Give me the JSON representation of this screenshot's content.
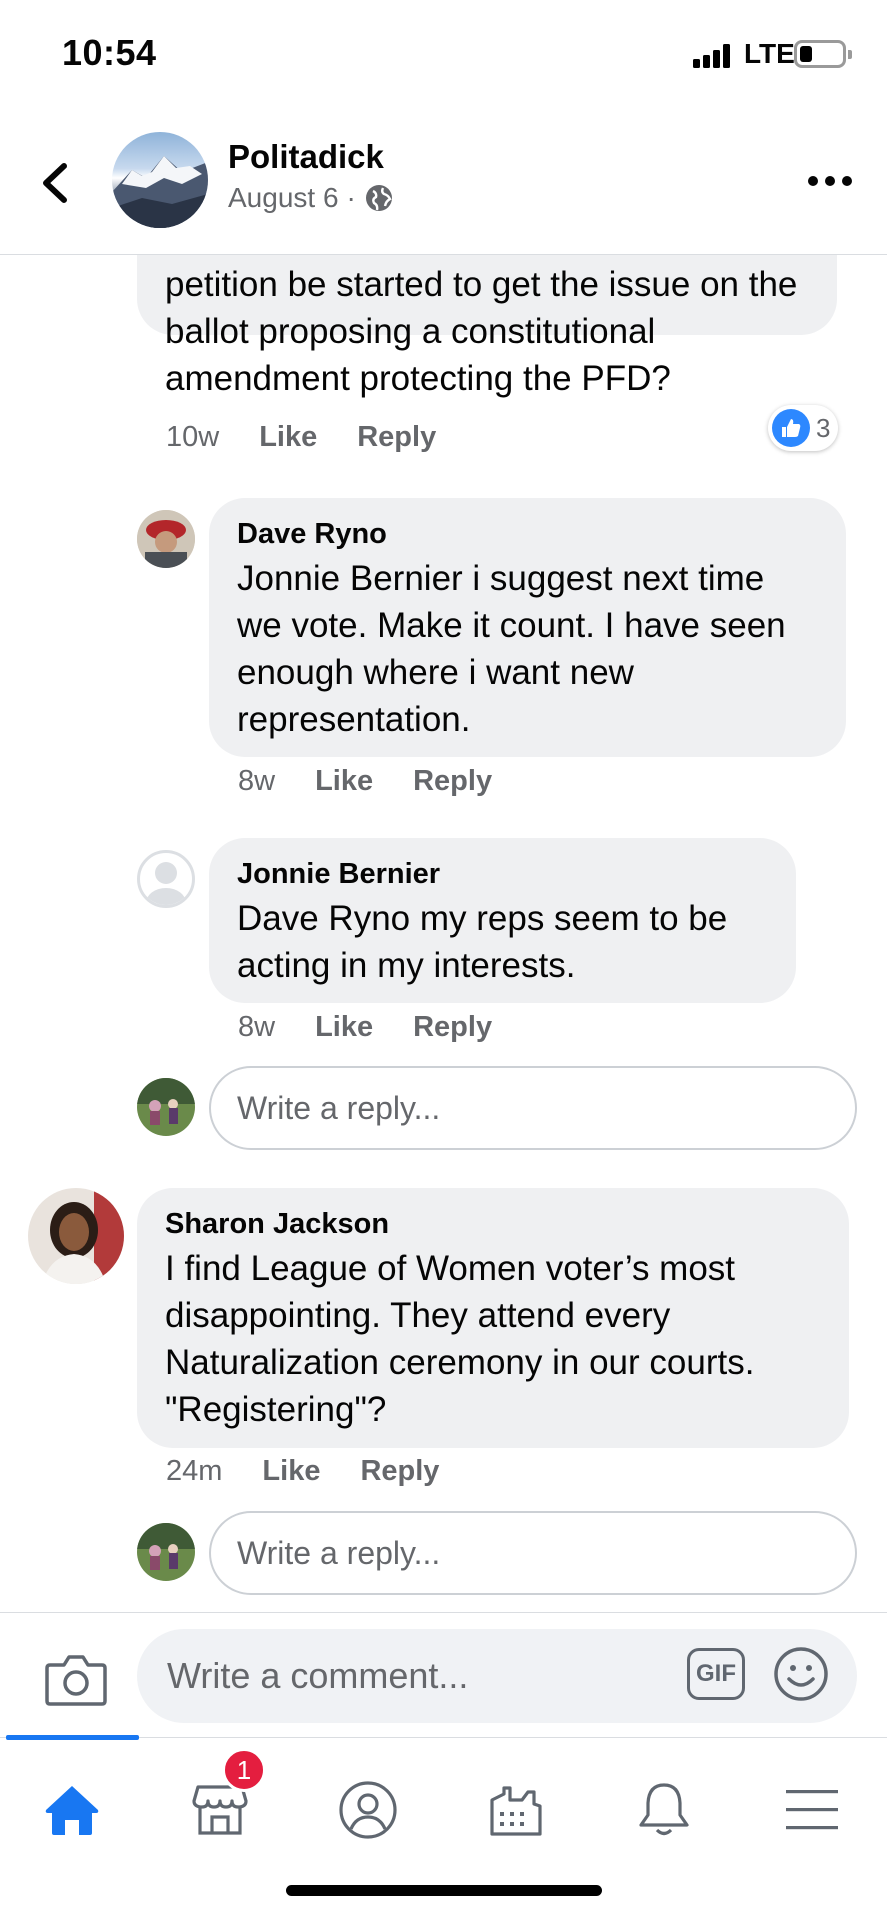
{
  "status_bar": {
    "time": "10:54",
    "network": "LTE"
  },
  "header": {
    "page_name": "Politadick",
    "date": "August 6",
    "separator": "·"
  },
  "comments": {
    "parent": {
      "partial_text": "petition be started to get the issue on the ballot proposing a constitutional amendment protecting the PFD?",
      "time": "10w",
      "like_label": "Like",
      "reply_label": "Reply",
      "reaction_count": "3"
    },
    "reply_1": {
      "author": "Dave Ryno",
      "text": "Jonnie Bernier i suggest next time we vote. Make it count. I have seen enough where i want new representation.",
      "time": "8w",
      "like_label": "Like",
      "reply_label": "Reply"
    },
    "reply_2": {
      "author": "Jonnie Bernier",
      "text": "Dave Ryno my reps seem to be acting in my interests.",
      "time": "8w",
      "like_label": "Like",
      "reply_label": "Reply"
    },
    "reply_box_1": {
      "placeholder": "Write a reply..."
    },
    "comment_2": {
      "author": "Sharon Jackson",
      "text": "I find League of Women voter’s most disappointing.  They attend every Naturalization ceremony in our courts.  \"Registering\"?",
      "time": "24m",
      "like_label": "Like",
      "reply_label": "Reply"
    },
    "reply_box_2": {
      "placeholder": "Write a reply..."
    }
  },
  "composer": {
    "placeholder": "Write a comment...",
    "gif_label": "GIF"
  },
  "tabbar": {
    "tabs": [
      "home-icon",
      "marketplace-icon",
      "profile-icon",
      "pages-icon",
      "notifications-icon",
      "menu-icon"
    ],
    "marketplace_badge": "1",
    "accent": "#1877f2"
  }
}
